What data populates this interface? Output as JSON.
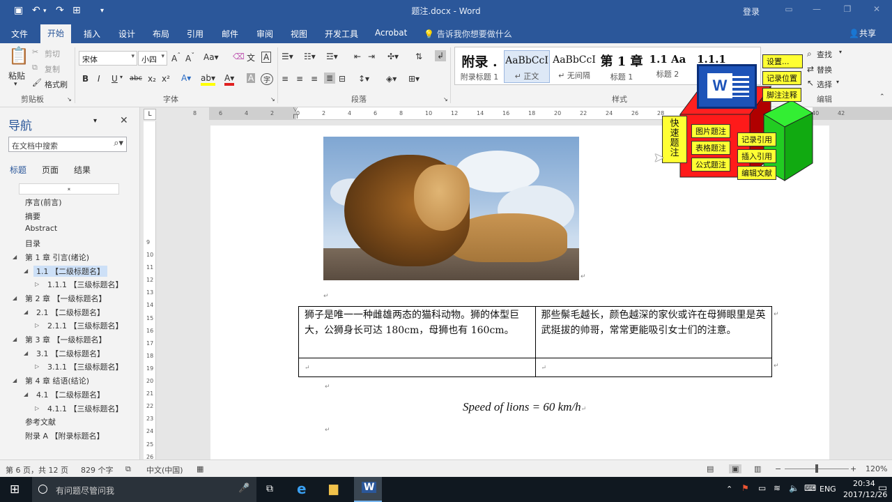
{
  "window": {
    "title": "题注.docx  -  Word",
    "login_label": "登录",
    "minimize_icon": "—",
    "restore_icon": "❐",
    "close_icon": "✕"
  },
  "quick_access": {
    "save_icon": "save-icon",
    "undo_icon": "undo-icon",
    "redo_icon": "redo-icon"
  },
  "tabs": [
    "文件",
    "开始",
    "插入",
    "设计",
    "布局",
    "引用",
    "邮件",
    "审阅",
    "视图",
    "开发工具",
    "Acrobat"
  ],
  "active_tab": "开始",
  "tell_me": "告诉我你想要做什么",
  "share_label": "共享",
  "ribbon": {
    "clipboard": {
      "paste": "粘贴",
      "cut": "剪切",
      "copy": "复制",
      "format_painter": "格式刷",
      "group": "剪贴板"
    },
    "font": {
      "name": "宋体",
      "size": "小四",
      "group": "字体"
    },
    "paragraph": {
      "group": "段落"
    },
    "styles": {
      "group": "样式",
      "items": [
        {
          "preview": "附录 .",
          "name": "附录标题 1"
        },
        {
          "preview": "AaBbCcI",
          "name": "↵ 正文"
        },
        {
          "preview": "AaBbCcI",
          "name": "↵ 无间隔"
        },
        {
          "preview": "第 1 章",
          "name": "标题 1"
        },
        {
          "preview": "1.1  Aa",
          "name": "标题 2"
        },
        {
          "preview": "1.1.1  A",
          "name": ""
        }
      ]
    },
    "editing": {
      "find": "查找",
      "replace": "替换",
      "select": "选择",
      "group": "编辑"
    }
  },
  "overlay": {
    "settings": "设置...",
    "record_position": "记录位置",
    "footnote": "脚注注释",
    "quick_caption": "快速题注",
    "figure_caption": "图片题注",
    "table_caption": "表格题注",
    "formula_caption": "公式题注",
    "record_ref": "记录引用",
    "insert_ref": "插入引用",
    "edit_ref": "编辑文献"
  },
  "nav": {
    "title": "导航",
    "search_placeholder": "在文档中搜索",
    "tabs": [
      "标题",
      "页面",
      "结果"
    ],
    "items": [
      {
        "label": "序言(前言)",
        "level": 1
      },
      {
        "label": "摘要",
        "level": 1
      },
      {
        "label": "Abstract",
        "level": 1
      },
      {
        "label": "目录",
        "level": 1
      },
      {
        "label": "第 1 章 引言(绪论)",
        "level": 1
      },
      {
        "label": "1.1 【二级标题名】",
        "level": 2
      },
      {
        "label": "1.1.1 【三级标题名】",
        "level": 3
      },
      {
        "label": "第 2 章 【一级标题名】",
        "level": 1
      },
      {
        "label": "2.1 【二级标题名】",
        "level": 2
      },
      {
        "label": "2.1.1 【三级标题名】",
        "level": 3
      },
      {
        "label": "第 3 章 【一级标题名】",
        "level": 1
      },
      {
        "label": "3.1 【二级标题名】",
        "level": 2
      },
      {
        "label": "3.1.1 【三级标题名】",
        "level": 3
      },
      {
        "label": "第 4 章 结语(结论)",
        "level": 1
      },
      {
        "label": "4.1 【二级标题名】",
        "level": 2
      },
      {
        "label": "4.1.1 【三级标题名】",
        "level": 3
      },
      {
        "label": "参考文献",
        "level": 1
      },
      {
        "label": "附录 A 【附录标题名】",
        "level": 1
      }
    ]
  },
  "document": {
    "table": [
      [
        "狮子是唯一一种雌雄两态的猫科动物。狮的体型巨大，公狮身长可达 180cm，母狮也有 160cm。",
        "那些鬃毛越长，颜色越深的家伙或许在母狮眼里是英武挺拔的帅哥，常常更能吸引女士们的注意。"
      ],
      [
        "",
        ""
      ]
    ],
    "formula": "Speed of lions = 60 km/h"
  },
  "status": {
    "page": "第 6 页，共 12 页",
    "words": "829 个字",
    "language": "中文(中国)",
    "zoom": "120%"
  },
  "taskbar": {
    "search_placeholder": "有问题尽管问我",
    "ime": "ENG",
    "time": "20:34",
    "date": "2017/12/26"
  }
}
